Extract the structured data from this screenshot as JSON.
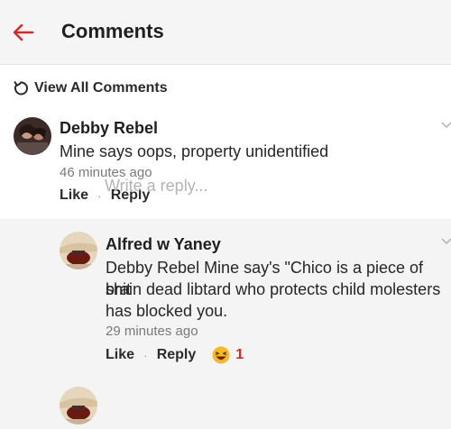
{
  "header": {
    "title": "Comments"
  },
  "view_all": {
    "label": "View All Comments"
  },
  "comment": {
    "author": "Debby Rebel",
    "text": "Mine says oops, property unidentified",
    "time": "46 minutes ago",
    "like_label": "Like",
    "separator": "·",
    "reply_label": "Reply"
  },
  "reply": {
    "author": "Alfred w Yaney",
    "text_lines": [
      "Debby Rebel Mine say's \"Chico is a piece of shit",
      "brain dead libtard who protects child molesters",
      "has blocked you."
    ],
    "time": "29 minutes ago",
    "like_label": "Like",
    "separator": "·",
    "reply_label": "Reply",
    "reaction_icon": "laughing-emoji",
    "reaction_count": "1"
  },
  "composer": {
    "placeholder": "Write a reply..."
  },
  "colors": {
    "accent": "#d62828",
    "header_bg": "#f5f5f5",
    "reply_bg": "#f4f4f4"
  }
}
